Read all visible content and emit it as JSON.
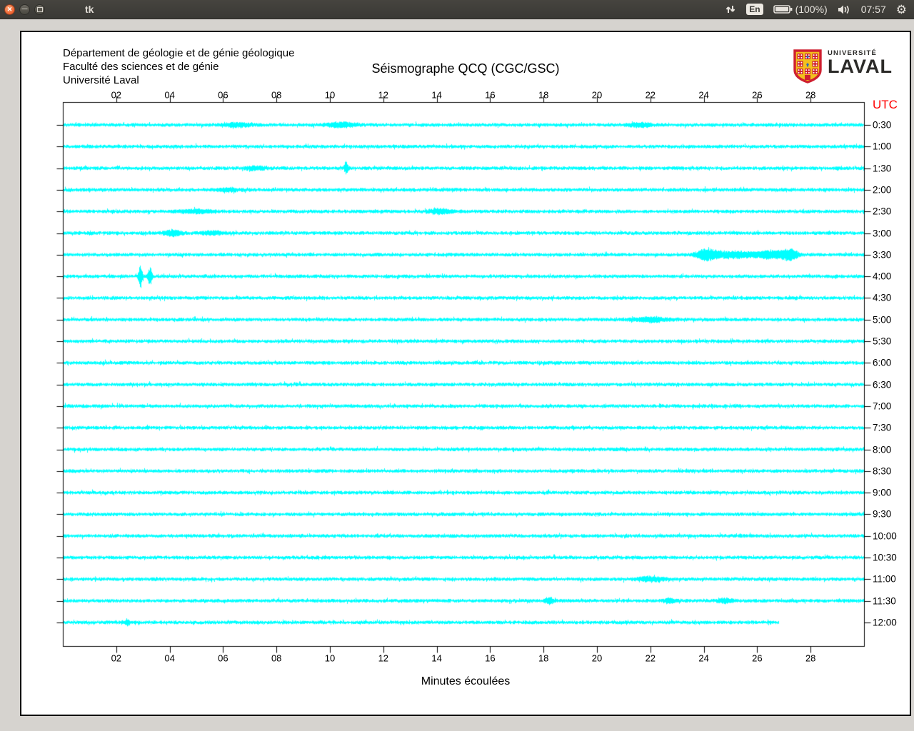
{
  "topbar": {
    "title": "tk",
    "close_glyph": "✕",
    "minimize_glyph": "—",
    "indicators": {
      "keyboard_layout": "En",
      "battery_label": "(100%)",
      "clock": "07:57"
    }
  },
  "sheet": {
    "header_lines": [
      "Département de géologie et de génie géologique",
      "Faculté des sciences et de génie",
      "Université Laval"
    ],
    "title": "Séismographe QCQ (CGC/GSC)",
    "logo": {
      "top_text": "UNIVERSITÉ",
      "bottom_text": "LAVAL",
      "red": "#cf2030",
      "gold": "#f2c01e",
      "blue": "#2f6eb6"
    },
    "xlabel": "Minutes écoulées",
    "right_axis_title": "UTC"
  },
  "chart_data": {
    "type": "line",
    "title": "Séismographe QCQ (CGC/GSC)",
    "xlabel": "Minutes écoulées",
    "x_ticks": [
      "02",
      "04",
      "06",
      "08",
      "10",
      "12",
      "14",
      "16",
      "18",
      "20",
      "22",
      "24",
      "26",
      "28"
    ],
    "xlim": [
      0,
      30
    ],
    "minutes_per_tick": 2,
    "right_axis_title": "UTC",
    "trace_color": "#00ffff",
    "utc_label_color": "#ff0000",
    "grid": false,
    "rows": [
      {
        "utc": "0:30",
        "end": 30,
        "events": [
          {
            "m": 6.5,
            "amp": 2.5,
            "w": 0.35
          },
          {
            "m": 10.4,
            "amp": 3,
            "w": 0.4
          },
          {
            "m": 21.6,
            "amp": 2.5,
            "w": 0.3
          }
        ]
      },
      {
        "utc": "1:00",
        "end": 30,
        "events": []
      },
      {
        "utc": "1:30",
        "end": 30,
        "events": [
          {
            "m": 7.2,
            "amp": 2,
            "w": 0.3
          },
          {
            "m": 10.6,
            "amp": 9,
            "w": 0.05
          }
        ]
      },
      {
        "utc": "2:00",
        "end": 30,
        "events": [
          {
            "m": 6.2,
            "amp": 2,
            "w": 0.3
          }
        ]
      },
      {
        "utc": "2:30",
        "end": 30,
        "events": [
          {
            "m": 5.0,
            "amp": 2.5,
            "w": 0.4
          },
          {
            "m": 14.1,
            "amp": 3,
            "w": 0.3
          }
        ]
      },
      {
        "utc": "3:00",
        "end": 30,
        "events": [
          {
            "m": 4.1,
            "amp": 4,
            "w": 0.22
          },
          {
            "m": 5.6,
            "amp": 2,
            "w": 0.3
          }
        ]
      },
      {
        "utc": "3:30",
        "end": 30,
        "events": [
          {
            "m": 24.1,
            "amp": 7,
            "w": 0.25
          },
          {
            "m": 25.1,
            "amp": 4,
            "w": 0.7
          },
          {
            "m": 26.5,
            "amp": 5,
            "w": 0.35
          },
          {
            "m": 27.2,
            "amp": 7,
            "w": 0.22
          }
        ]
      },
      {
        "utc": "4:00",
        "end": 30,
        "events": [
          {
            "m": 2.9,
            "amp": 16,
            "w": 0.05
          },
          {
            "m": 3.25,
            "amp": 13,
            "w": 0.05
          }
        ]
      },
      {
        "utc": "4:30",
        "end": 30,
        "events": []
      },
      {
        "utc": "5:00",
        "end": 30,
        "events": [
          {
            "m": 22.0,
            "amp": 3,
            "w": 0.45
          }
        ]
      },
      {
        "utc": "5:30",
        "end": 30,
        "events": []
      },
      {
        "utc": "6:00",
        "end": 30,
        "events": []
      },
      {
        "utc": "6:30",
        "end": 30,
        "events": []
      },
      {
        "utc": "7:00",
        "end": 30,
        "events": []
      },
      {
        "utc": "7:30",
        "end": 30,
        "events": []
      },
      {
        "utc": "8:00",
        "end": 30,
        "events": []
      },
      {
        "utc": "8:30",
        "end": 30,
        "events": []
      },
      {
        "utc": "9:00",
        "end": 30,
        "events": []
      },
      {
        "utc": "9:30",
        "end": 30,
        "events": []
      },
      {
        "utc": "10:00",
        "end": 30,
        "events": []
      },
      {
        "utc": "10:30",
        "end": 30,
        "events": []
      },
      {
        "utc": "11:00",
        "end": 30,
        "events": [
          {
            "m": 22.0,
            "amp": 3,
            "w": 0.35
          }
        ]
      },
      {
        "utc": "11:30",
        "end": 30,
        "events": [
          {
            "m": 18.2,
            "amp": 4,
            "w": 0.12
          },
          {
            "m": 22.7,
            "amp": 3,
            "w": 0.15
          },
          {
            "m": 24.8,
            "amp": 3,
            "w": 0.2
          }
        ]
      },
      {
        "utc": "12:00",
        "end": 26.8,
        "events": [
          {
            "m": 2.4,
            "amp": 4,
            "w": 0.07
          }
        ]
      }
    ]
  }
}
